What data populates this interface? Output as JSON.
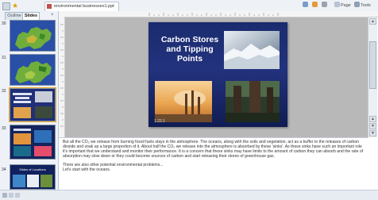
{
  "window": {
    "doc_tab_label": "environmental businesses1.ppt",
    "toolbar": {
      "home_label": "",
      "feeds_label": "",
      "print_label": "",
      "page_label": "Page",
      "tools_label": "Tools"
    }
  },
  "left_pane": {
    "tabs": {
      "outline": "Outline",
      "slides": "Slides"
    },
    "close_label": "×",
    "thumbnails": [
      {
        "number": "30"
      },
      {
        "number": "31"
      },
      {
        "number": "32"
      },
      {
        "number": "33"
      },
      {
        "number": "34",
        "caption": "Slides of Locations"
      }
    ]
  },
  "slide": {
    "title": "Carbon Stores and Tipping Points",
    "footer": "1.22.1"
  },
  "notes": {
    "paragraph_1": "But all the CO₂ we release from burning fossil fuels stays in the atmosphere. The oceans, along with the soils and vegetation, act as a buffer to the releases of carbon dioxide and soak up a large proportion of it. About half the CO₂ we release into the atmosphere is absorbed by these 'sinks'. As these sinks have such an important role it's important that we understand and monitor their performance. It is a concern that these sinks may have limits to the amount of carbon they can absorb and the rate of absorption may slow down or they could become sources of carbon and start releasing their stores of greenhouse gas.",
    "paragraph_2": "There are also other potential environmental problems...",
    "paragraph_3": "Let's start with the oceans."
  },
  "colors": {
    "slide_bg": "#1a2c6e",
    "selection": "#f0a830",
    "workspace": "#b8b8b8"
  }
}
